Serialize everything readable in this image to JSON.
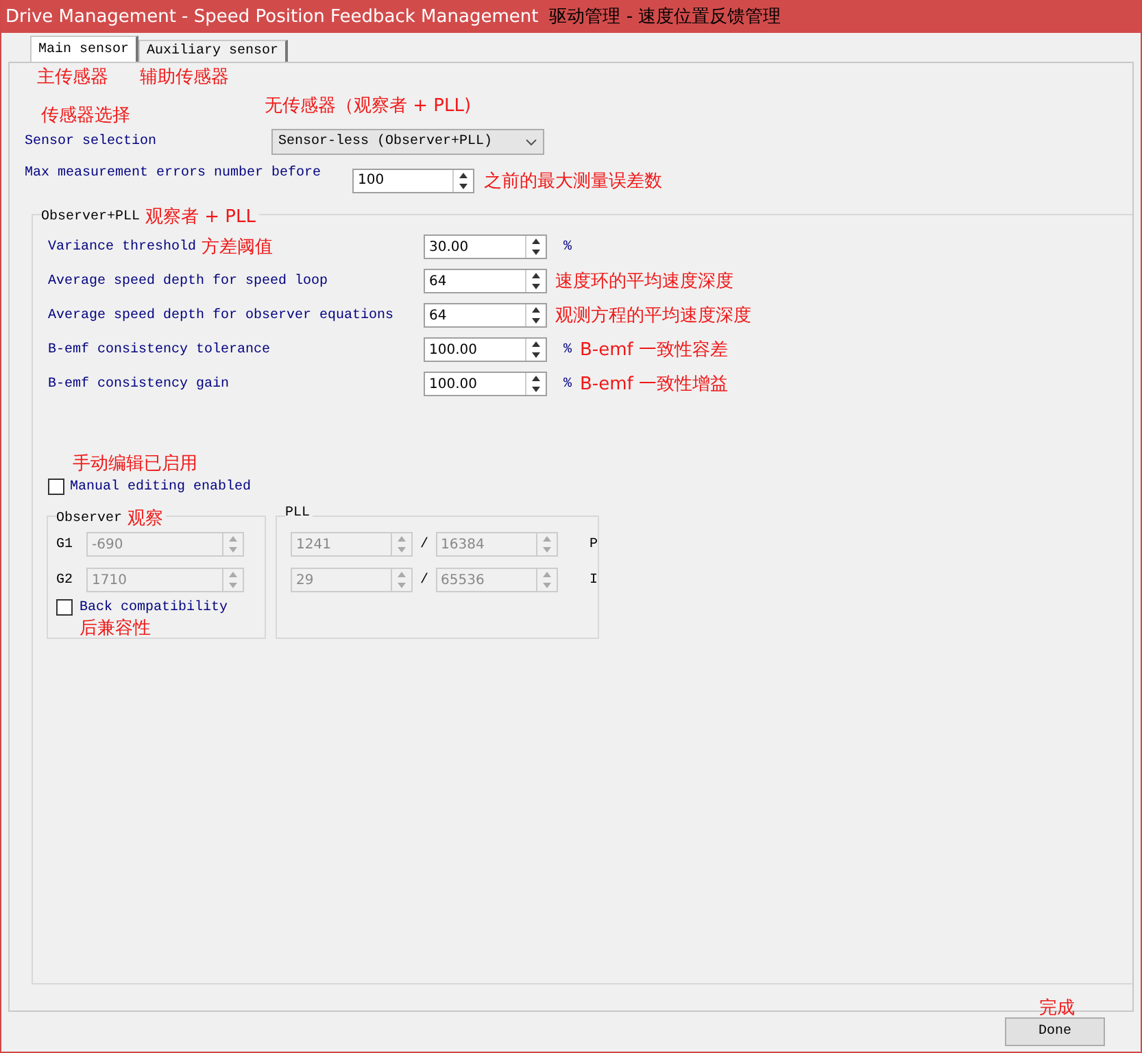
{
  "window": {
    "title": "Drive Management - Speed Position Feedback Management",
    "title_annotation": "驱动管理 - 速度位置反馈管理"
  },
  "tabs": [
    {
      "label": "Main sensor",
      "annotation": "主传感器",
      "selected": true
    },
    {
      "label": "Auxiliary sensor",
      "annotation": "辅助传感器",
      "selected": false
    }
  ],
  "sensor_selection": {
    "annotation": "传感器选择",
    "label": "Sensor selection",
    "value": "Sensor-less (Observer+PLL)",
    "value_annotation": "无传感器（观察者 + PLL)"
  },
  "max_errors": {
    "label": "Max measurement errors number before",
    "value": "100",
    "annotation": "之前的最大测量误差数"
  },
  "observer_pll": {
    "title": "Observer+PLL",
    "annotation": "观察者 + PLL",
    "params": [
      {
        "label": "Variance threshold",
        "label_annotation": "方差阈值",
        "value": "30.00",
        "unit": "%"
      },
      {
        "label": "Average speed depth for speed loop",
        "value": "64",
        "annotation": "速度环的平均速度深度"
      },
      {
        "label": "Average speed depth for observer equations",
        "value": "64",
        "annotation": "观测方程的平均速度深度"
      },
      {
        "label": "B-emf consistency tolerance",
        "value": "100.00",
        "unit": "%",
        "annotation": "B-emf 一致性容差"
      },
      {
        "label": "B-emf consistency gain",
        "value": "100.00",
        "unit": "%",
        "annotation": "B-emf 一致性增益"
      }
    ]
  },
  "manual_editing": {
    "annotation": "手动编辑已启用",
    "label": "Manual editing enabled",
    "checked": false
  },
  "observer": {
    "title": "Observer",
    "annotation": "观察",
    "gains": [
      {
        "label": "G1",
        "value": "-690",
        "disabled": true
      },
      {
        "label": "G2",
        "value": "1710",
        "disabled": true
      }
    ],
    "back_compatibility": {
      "label": "Back compatibility",
      "checked": false,
      "annotation": "后兼容性"
    }
  },
  "pll": {
    "title": "PLL",
    "rows": [
      {
        "numerator": "1241",
        "denominator": "16384",
        "label": "P",
        "separator": "/",
        "disabled": true
      },
      {
        "numerator": "29",
        "denominator": "65536",
        "label": "I",
        "separator": "/",
        "disabled": true
      }
    ]
  },
  "done_button": {
    "annotation": "完成",
    "label": "Done"
  }
}
